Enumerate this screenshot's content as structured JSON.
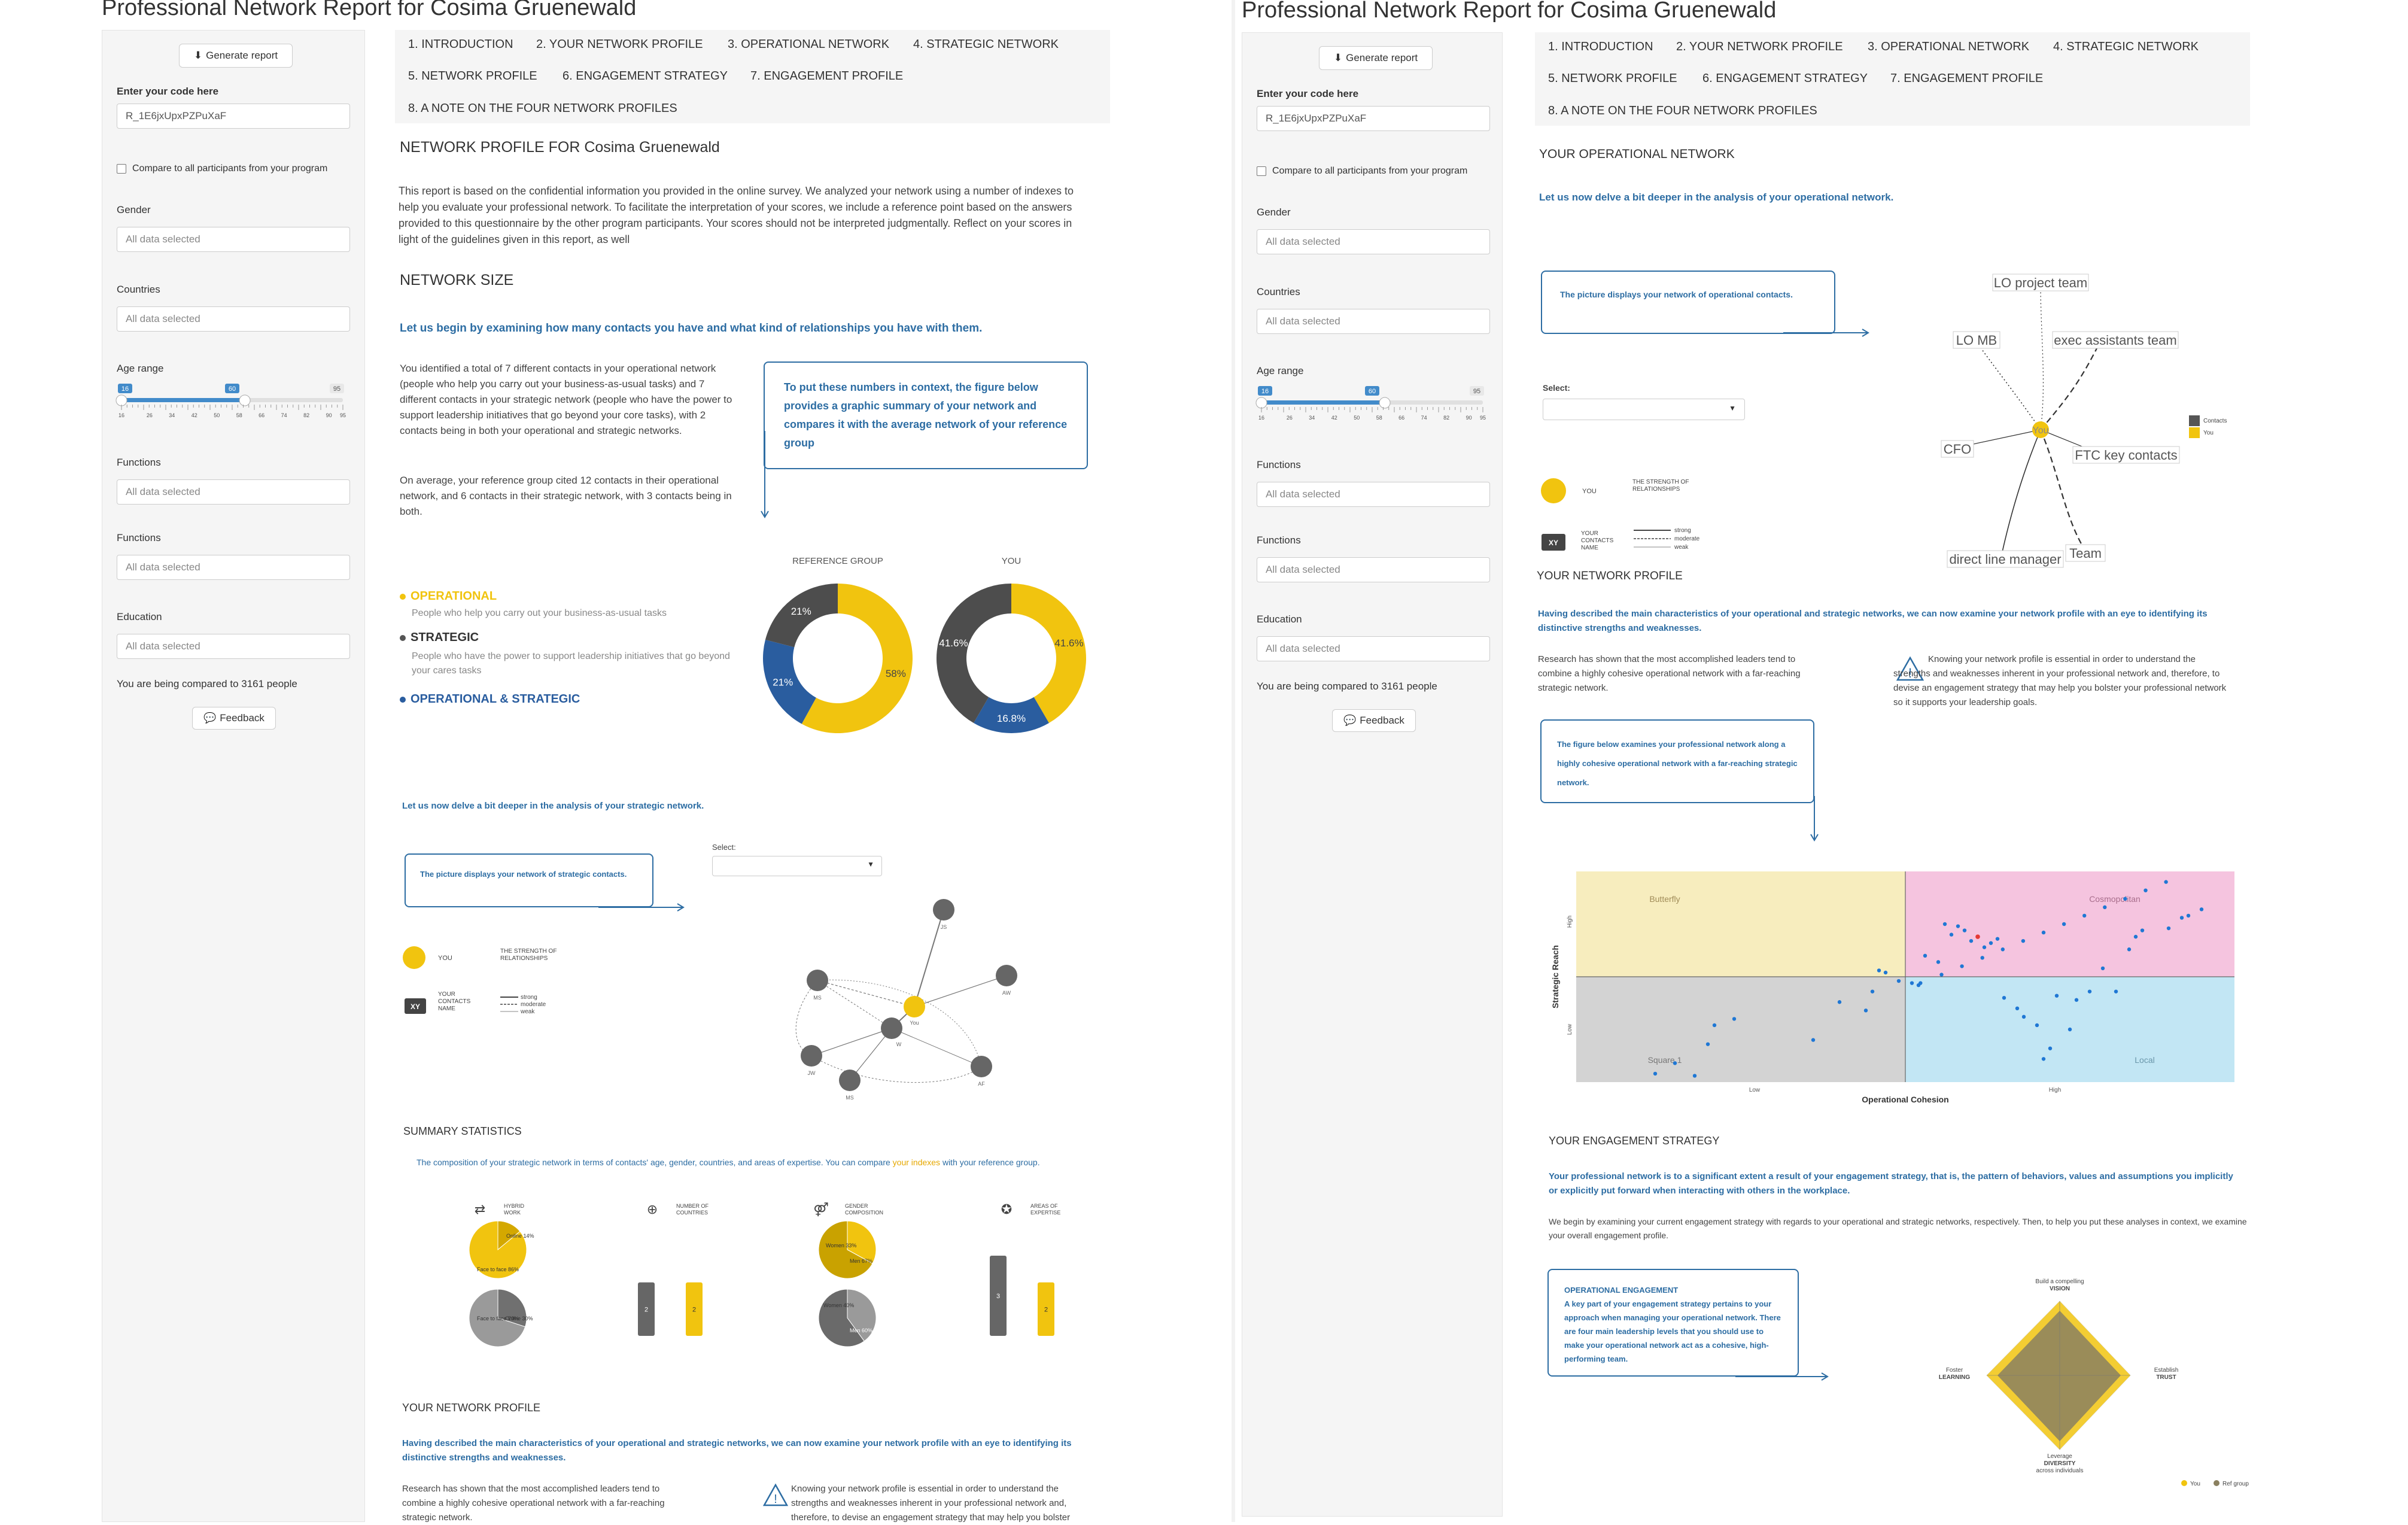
{
  "report_title": "Professional Network Report for Cosima Gruenewald",
  "sidebar": {
    "generate_label": "Generate report",
    "code_label": "Enter your code here",
    "code_value": "R_1E6jxUpxPZPuXaF",
    "compare_label": "Compare to all participants from your program",
    "gender_label": "Gender",
    "countries_label": "Countries",
    "age_label": "Age range",
    "functions_label": "Functions",
    "education_label": "Education",
    "placeholder": "All data selected",
    "age_min": "16",
    "age_low": "16",
    "age_high": "60",
    "age_max": "95",
    "age_low_value": 16,
    "age_high_value": 60,
    "age_ticks": [
      "16",
      "26",
      "34",
      "42",
      "50",
      "58",
      "66",
      "74",
      "82",
      "90",
      "95"
    ],
    "compared_text": "You are being compared to 3161 people",
    "feedback_label": "Feedback"
  },
  "tabs": [
    "1. INTRODUCTION",
    "2. YOUR NETWORK PROFILE",
    "3. OPERATIONAL NETWORK",
    "4. STRATEGIC NETWORK",
    "5. NETWORK PROFILE",
    "6. ENGAGEMENT STRATEGY",
    "7. ENGAGEMENT PROFILE",
    "8. A NOTE ON THE FOUR NETWORK PROFILES"
  ],
  "left": {
    "profile_heading": "NETWORK PROFILE FOR Cosima Gruenewald",
    "intro_text": "This report is based on the confidential information you provided in the online survey. We analyzed your network using a number of indexes to help you evaluate your professional network. To facilitate the interpretation of your scores, we include a reference point based on the answers provided to this questionnaire by the other program participants. Your scores should not be interpreted judgmentally. Reflect on your scores in light of the guidelines given in this report, as well",
    "size_heading": "NETWORK SIZE",
    "size_lead": "Let us begin by examining how many contacts you have and what kind of relationships you have with them.",
    "size_p1": "You identified a total of 7 different contacts in your operational network (people who help you carry out your business-as-usual tasks) and 7 different contacts in your strategic network (people who have the power to support leadership initiatives that go beyond your core tasks), with 2 contacts being in both your operational and strategic networks.",
    "size_p2": "On average, your reference group cited 12 contacts in their operational network, and 6 contacts in their strategic network, with 3 contacts being in both.",
    "size_callout": "To put these numbers in context, the figure below provides a graphic summary of your network and compares it with the average network of your reference group",
    "legend": {
      "op_title": "OPERATIONAL",
      "op_desc": "People who help you carry out your business-as-usual tasks",
      "st_title": "STRATEGIC",
      "st_desc": "People who have the power to support leadership initiatives that go beyond your cares tasks",
      "both_title": "OPERATIONAL & STRATEGIC"
    },
    "strategic_lead": "Let us now delve a bit deeper in the analysis of your strategic network.",
    "strategic_callout": "The picture displays your network of strategic contacts.",
    "select_label": "Select:",
    "key": {
      "you": "YOU",
      "strength": "THE STRENGTH OF RELATIONSHIPS",
      "xy": "XY",
      "contacts_name": "YOUR CONTACTS NAME",
      "strong": "strong",
      "moderate": "moderate",
      "weak": "weak"
    },
    "strategic_nodes": [
      "JS",
      "MS",
      "You",
      "W",
      "AF",
      "JW",
      "MS",
      "AW"
    ],
    "summary_heading": "SUMMARY STATISTICS",
    "summary_lead_a": "The composition of your strategic network in terms of contacts' age, gender, countries, and areas of expertise. You can compare",
    "summary_lead_link": "your indexes",
    "summary_lead_b": "with your reference group.",
    "stat_titles": [
      "HYBRID WORK",
      "NUMBER OF COUNTRIES",
      "GENDER COMPOSITION",
      "AREAS OF EXPERTISE"
    ],
    "hybrid_labels": [
      "Online 14%",
      "Face to face 86%",
      "Face to face 70%",
      "Online 30%"
    ],
    "gender_labels": [
      "Women 33%",
      "Men 67%",
      "Women 40%",
      "Men 60%"
    ],
    "countries_values": [
      "2",
      "2"
    ],
    "expertise_values": [
      "3",
      "2"
    ],
    "profile_heading2": "YOUR NETWORK PROFILE",
    "profile_lead": "Having described the main characteristics of your operational and strategic networks, we can now examine your network profile with an eye to identifying its distinctive strengths and weaknesses.",
    "profile_p1": "Research has shown that the most accomplished leaders tend to combine a highly cohesive operational network with a far-reaching strategic network.",
    "profile_p2": "Knowing your network profile is essential in order to understand the strengths and weaknesses inherent in your professional network and, therefore, to devise an engagement strategy that may help you bolster"
  },
  "donuts": {
    "ref_label": "REFERENCE GROUP",
    "you_label": "YOU",
    "ref": [
      {
        "name": "OPERATIONAL",
        "value": 58,
        "label": "58%"
      },
      {
        "name": "OPERATIONAL & STRATEGIC",
        "value": 21,
        "label": "21%"
      },
      {
        "name": "STRATEGIC",
        "value": 21,
        "label": "21%"
      }
    ],
    "you": [
      {
        "name": "OPERATIONAL",
        "value": 41.6,
        "label": "41.6%"
      },
      {
        "name": "OPERATIONAL & STRATEGIC",
        "value": 16.8,
        "label": "16.8%"
      },
      {
        "name": "STRATEGIC",
        "value": 41.6,
        "label": "41.6%"
      }
    ]
  },
  "right": {
    "op_heading": "YOUR OPERATIONAL NETWORK",
    "op_lead": "Let us now delve a bit deeper in the analysis of your operational network.",
    "op_callout": "The picture displays your network of operational contacts.",
    "select_label": "Select:",
    "op_nodes": [
      "LO project team",
      "LO MB",
      "exec assistants team",
      "You",
      "CFO",
      "FTC key contacts",
      "direct line manager",
      "Team"
    ],
    "op_legend": [
      "Contacts",
      "You"
    ],
    "profile_heading": "YOUR NETWORK PROFILE",
    "profile_lead": "Having described the main characteristics of your operational and strategic networks, we can now examine your network profile with an eye to identifying its distinctive strengths and weaknesses.",
    "profile_p1": "Research has shown that the most accomplished leaders tend to combine a highly cohesive operational network with a far-reaching strategic network.",
    "profile_p2": "Knowing your network profile is essential in order to understand the strengths and weaknesses inherent in your professional network and, therefore, to devise an engagement strategy that may help you bolster your professional network so it supports your leadership goals.",
    "quad_callout": "The figure below examines your professional network along a highly cohesive operational network with a far-reaching strategic network.",
    "quadrants": [
      "Butterfly",
      "Cosmopolitan",
      "Square 1",
      "Local"
    ],
    "y_axis": "Strategic Reach",
    "y_low": "Low",
    "y_high": "High",
    "x_axis": "Operational Cohesion",
    "x_low": "Low",
    "x_high": "High",
    "engagement_heading": "YOUR ENGAGEMENT STRATEGY",
    "engagement_lead": "Your professional network is to a significant extent a result of your engagement strategy, that is, the pattern of behaviors, values and assumptions you implicitly or explicitly put forward when interacting with others in the workplace.",
    "engagement_p": "We begin by examining your current engagement strategy with regards to your operational and strategic networks, respectively. Then, to help you put these analyses in context, we examine your overall engagement profile.",
    "oe_title": "OPERATIONAL ENGAGEMENT",
    "oe_text": "A key part of your engagement strategy pertains to your approach when managing your operational network. There are four main leadership levels that you should use to make your operational network act as a cohesive, high-performing team.",
    "radar_top_a": "Build a compelling",
    "radar_top_b": "VISION",
    "radar_left_a": "Foster",
    "radar_left_b": "LEARNING",
    "radar_right_a": "Establish",
    "radar_right_b": "TRUST",
    "radar_bottom_a": "Leverage",
    "radar_bottom_b": "DIVERSITY",
    "radar_bottom_c": "across individuals",
    "radar_legend": [
      "You",
      "Ref group"
    ]
  },
  "chart_data": [
    {
      "type": "pie",
      "title": "REFERENCE GROUP",
      "categories": [
        "OPERATIONAL",
        "OPERATIONAL & STRATEGIC",
        "STRATEGIC"
      ],
      "values": [
        58,
        21,
        21
      ]
    },
    {
      "type": "pie",
      "title": "YOU",
      "categories": [
        "OPERATIONAL",
        "OPERATIONAL & STRATEGIC",
        "STRATEGIC"
      ],
      "values": [
        41.6,
        16.8,
        41.6
      ]
    },
    {
      "type": "scatter",
      "xlabel": "Operational Cohesion",
      "ylabel": "Strategic Reach",
      "xlim": [
        0,
        100
      ],
      "ylim": [
        0,
        100
      ],
      "series": [
        {
          "x": [
            12,
            15,
            18,
            20,
            21,
            24,
            36,
            40,
            44,
            45,
            46,
            47,
            49,
            51,
            52,
            53,
            55,
            56,
            57,
            58,
            59,
            60,
            62,
            63,
            64,
            65,
            67,
            68,
            70,
            71,
            72,
            73,
            75,
            76,
            78,
            80,
            82,
            84,
            85,
            86,
            90,
            92,
            93,
            95,
            52.3,
            55.5,
            58.6,
            61.7,
            64.8,
            67.9,
            71.0,
            74.1,
            77.2,
            80.3,
            83.4,
            86.5,
            89.6
          ],
          "y": [
            4,
            9,
            3,
            18,
            27,
            30,
            20,
            38,
            34,
            43,
            53,
            52,
            48,
            47,
            46,
            60,
            57,
            75,
            70,
            74,
            72,
            67,
            64,
            66,
            68,
            40,
            35,
            31,
            27,
            11,
            16,
            41,
            25,
            39,
            43,
            54,
            43,
            63,
            69,
            72,
            73,
            78,
            79,
            82,
            47,
            51,
            55,
            59,
            63,
            67,
            71,
            75,
            79,
            83,
            87,
            91,
            95
          ]
        },
        {
          "x": [
            61
          ],
          "y": [
            69
          ]
        }
      ]
    },
    {
      "type": "bar",
      "title": "NUMBER OF COUNTRIES",
      "values": [
        2,
        2
      ]
    },
    {
      "type": "bar",
      "title": "AREAS OF EXPERTISE",
      "values": [
        3,
        2
      ]
    }
  ]
}
